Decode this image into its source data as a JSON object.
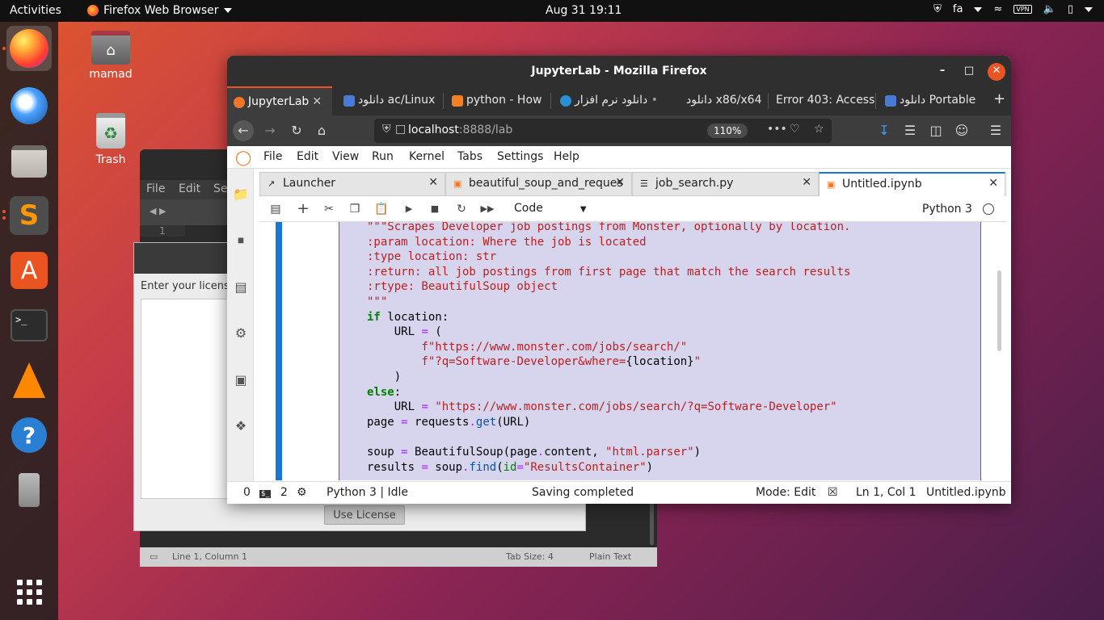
{
  "topbar": {
    "activities": "Activities",
    "app_menu": "Firefox Web Browser",
    "clock": "Aug 31  19:11",
    "keyboard_layout": "fa",
    "vpn_label": "VPN"
  },
  "desktop": {
    "home_label": "mamad",
    "trash_label": "Trash"
  },
  "editor_window": {
    "menu": [
      "File",
      "Edit",
      "Se"
    ],
    "line_number": "1",
    "status_position": "Line 1, Column 1",
    "status_tab": "Tab Size: 4",
    "status_syntax": "Plain Text"
  },
  "license_window": {
    "label": "Enter your license",
    "button": "Use License"
  },
  "firefox": {
    "title": "JupyterLab - Mozilla Firefox",
    "tabs": [
      {
        "label": "JupyterLab",
        "active": true
      },
      {
        "label": "دانلود ac/Linux"
      },
      {
        "label": "python - How"
      },
      {
        "label": "دانلود نرم افزار"
      },
      {
        "label": "دانلود x86/x64"
      },
      {
        "label": "Error 403: Access"
      },
      {
        "label": "دانلود Portable"
      }
    ],
    "url_host": "localhost",
    "url_rest": ":8888/lab",
    "zoom": "110%"
  },
  "jupyter": {
    "menu": [
      "File",
      "Edit",
      "View",
      "Run",
      "Kernel",
      "Tabs",
      "Settings",
      "Help"
    ],
    "doc_tabs": [
      {
        "label": "Launcher"
      },
      {
        "label": "beautiful_soup_and_reques"
      },
      {
        "label": "job_search.py"
      },
      {
        "label": "Untitled.ipynb",
        "active": true
      }
    ],
    "cell_type": "Code",
    "kernel": "Python 3",
    "status": {
      "terminals": "0",
      "kernels": "2",
      "kernel_state": "Python 3 | Idle",
      "message": "Saving completed",
      "mode": "Mode: Edit",
      "position": "Ln 1, Col 1",
      "file": "Untitled.ipynb"
    }
  }
}
